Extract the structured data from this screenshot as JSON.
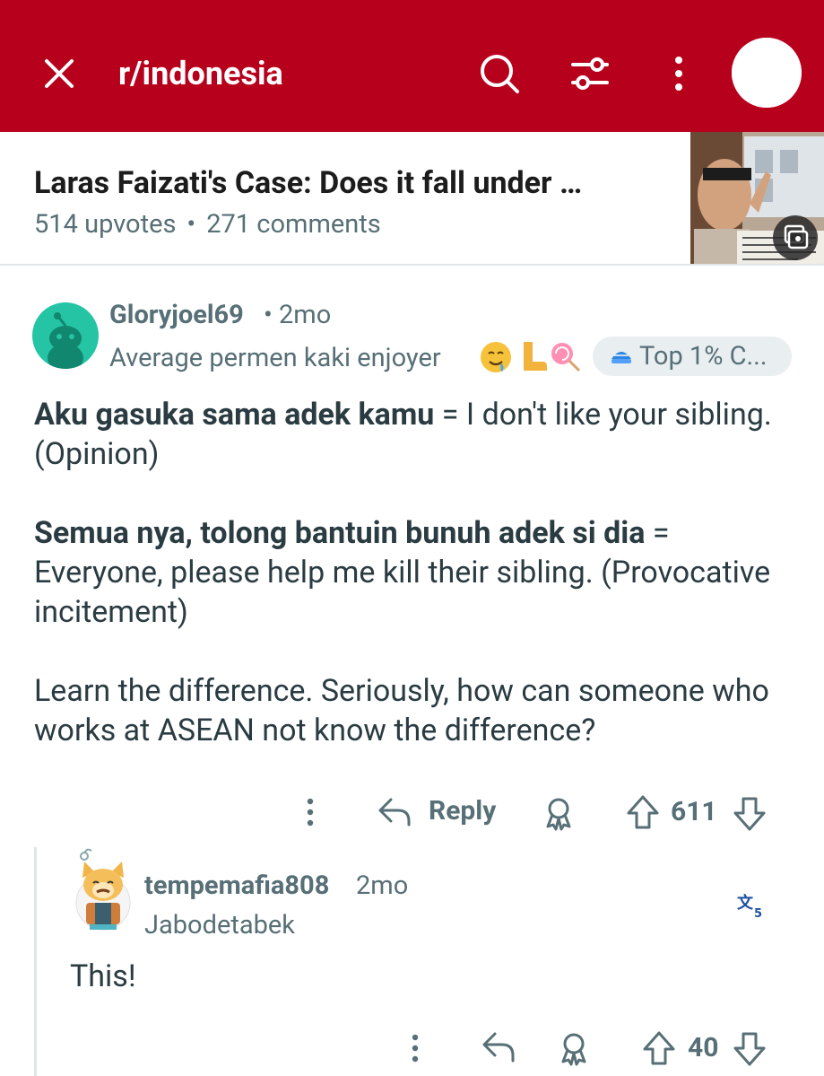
{
  "colors": {
    "top_bar": "#b7001c",
    "meta_text": "#576f76",
    "body_text": "#2a3c42",
    "online_dot": "#20b54a"
  },
  "top_bar": {
    "subreddit": "r/indonesia",
    "icons": [
      "close-icon",
      "search-icon",
      "filter-icon",
      "more-vertical-icon",
      "avatar"
    ]
  },
  "post": {
    "title": "Laras Faizati's Case: Does it fall under …",
    "upvotes": "514 upvotes",
    "separator": "•",
    "comments": "271 comments"
  },
  "comment1": {
    "username": "Gloryjoel69",
    "time": "• 2mo",
    "flair": "Average permen kaki enjoyer",
    "flair_emojis": [
      "drooling-face",
      "foot",
      "lollipop"
    ],
    "badge": "Top 1% C...",
    "body": {
      "p1_bold": "Aku gasuka sama adek kamu",
      "p1_rest": " = I don't like your sibling. (Opinion)",
      "p2_bold": "Semua nya, tolong bantuin bunuh adek si dia",
      "p2_rest": " = Everyone, please help me kill their sibling. (Provocative incitement)",
      "p3": "Learn the difference. Seriously, how can someone who works at ASEAN not know the difference?"
    },
    "actions": {
      "reply_label": "Reply",
      "votes": "611"
    }
  },
  "comment2": {
    "username": "tempemafia808",
    "time": "2mo",
    "flair": "Jabodetabek",
    "body": "This!",
    "actions": {
      "votes": "40"
    }
  }
}
